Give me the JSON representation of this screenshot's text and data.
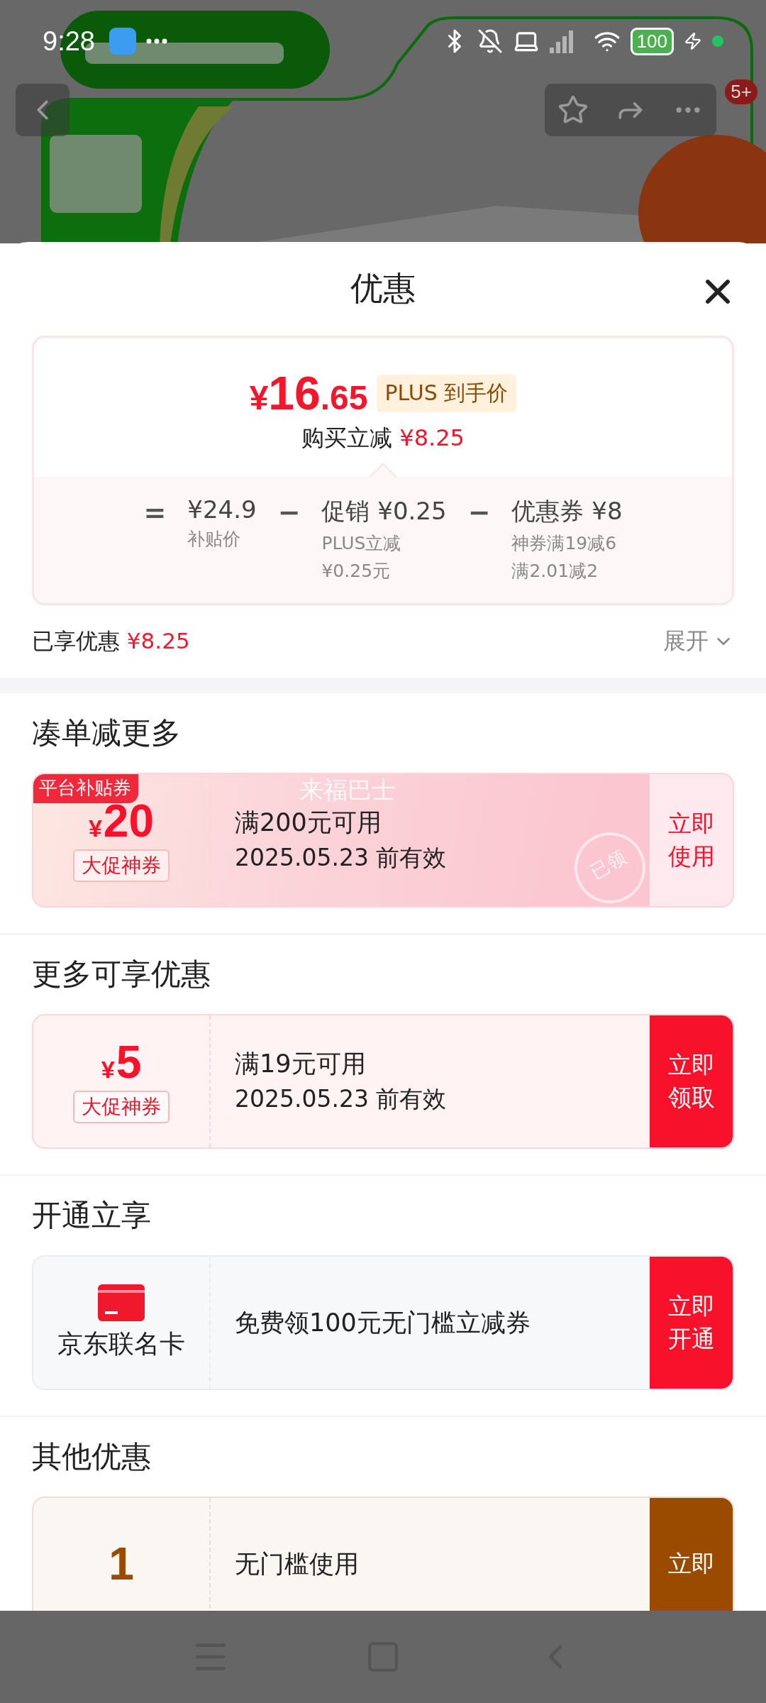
{
  "status_bar": {
    "time": "9:28",
    "battery": "100"
  },
  "top_nav": {
    "badge": "5+"
  },
  "sheet": {
    "title": "优惠",
    "price_card": {
      "currency": "¥",
      "price_int": "16",
      "price_dec": ".65",
      "price_tag": "PLUS 到手价",
      "saving_label": "购买立减",
      "saving_amount": "¥8.25",
      "breakdown": [
        {
          "kind": "operator",
          "text": "="
        },
        {
          "kind": "term",
          "value": "¥24.9",
          "notes": [
            "补贴价"
          ]
        },
        {
          "kind": "operator",
          "text": "−"
        },
        {
          "kind": "term",
          "value": "促销 ¥0.25",
          "notes": [
            "PLUS立减",
            "¥0.25元"
          ]
        },
        {
          "kind": "operator",
          "text": "−"
        },
        {
          "kind": "term",
          "value": "优惠券 ¥8",
          "notes": [
            "神券满19减6",
            "满2.01减2"
          ]
        }
      ]
    },
    "summary": {
      "label": "已享优惠",
      "amount": "¥8.25",
      "expand": "展开"
    },
    "sections": [
      {
        "title": "凑单减更多",
        "offers": [
          {
            "kind": "coupon",
            "color": "#f8112b",
            "claimed": true,
            "badge": "平台补贴券",
            "currency": "¥",
            "amount": "20",
            "tag": "大促神券",
            "condition": "满200元可用",
            "validity": "2025.05.23 前有效",
            "watermark": "来福巴士",
            "stamp": "已领",
            "action": "立即使用"
          }
        ]
      },
      {
        "title": "更多可享优惠",
        "offers": [
          {
            "kind": "coupon",
            "color": "#f8112b",
            "claimed": false,
            "currency": "¥",
            "amount": "5",
            "tag": "大促神券",
            "condition": "满19元可用",
            "validity": "2025.05.23 前有效",
            "action": "立即领取"
          }
        ]
      },
      {
        "title": "开通立享",
        "offers": [
          {
            "kind": "card",
            "color": "#f8112b",
            "claimed": false,
            "label": "京东联名卡",
            "condition": "免费领100元无门槛立减券",
            "action": "立即开通"
          }
        ]
      },
      {
        "title": "其他优惠",
        "offers": [
          {
            "kind": "coupon",
            "color": "#9a4b00",
            "claimed": false,
            "amount": "1",
            "condition": "无门槛使用",
            "action": "立即"
          }
        ]
      }
    ]
  }
}
